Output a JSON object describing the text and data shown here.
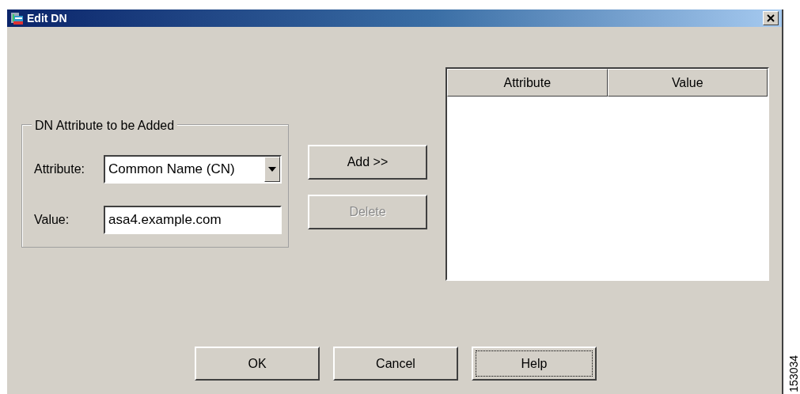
{
  "window": {
    "title": "Edit DN"
  },
  "group": {
    "title": "DN Attribute to be Added",
    "fields": [
      {
        "kind": "select",
        "label": "Attribute:",
        "value": "Common Name (CN)"
      },
      {
        "kind": "text",
        "label": "Value:",
        "value": "asa4.example.com"
      }
    ]
  },
  "side_buttons": [
    {
      "label": "Add >>",
      "disabled": false
    },
    {
      "label": "Delete",
      "disabled": true
    }
  ],
  "table": {
    "columns": [
      "Attribute",
      "Value"
    ]
  },
  "buttons": [
    {
      "label": "OK",
      "focused": false
    },
    {
      "label": "Cancel",
      "focused": false
    },
    {
      "label": "Help",
      "focused": true
    }
  ],
  "figure_number": "153034"
}
